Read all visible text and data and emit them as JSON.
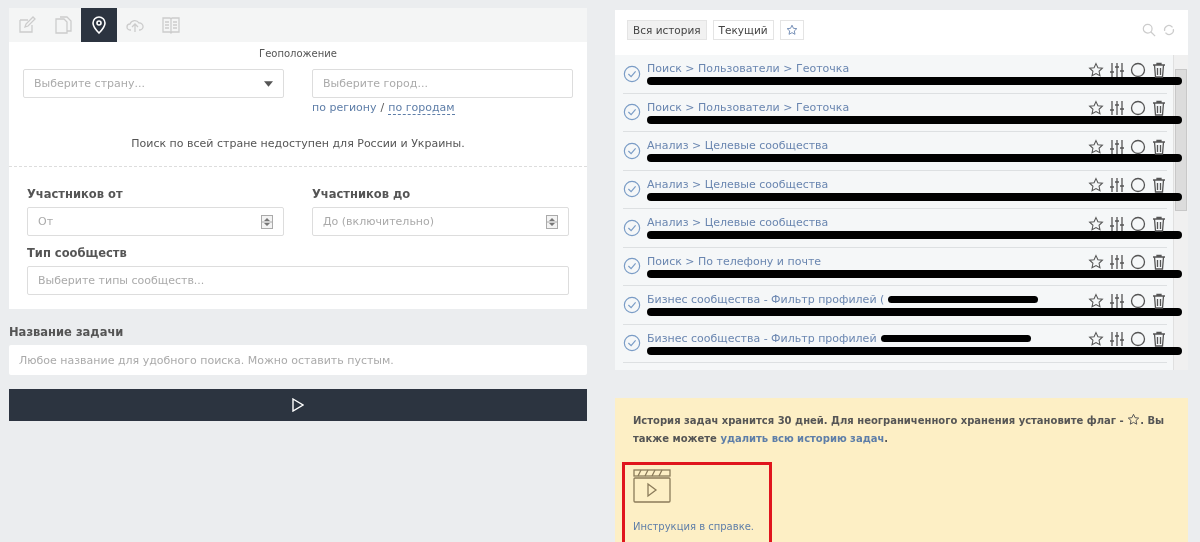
{
  "tabs": [
    {
      "kind": "edit",
      "selected": false
    },
    {
      "kind": "copy",
      "selected": false
    },
    {
      "kind": "pin",
      "selected": true
    },
    {
      "kind": "cloud",
      "selected": false
    },
    {
      "kind": "book",
      "selected": false
    }
  ],
  "geo": {
    "title": "Геоположение",
    "country": {
      "placeholder": "Выберите страну..."
    },
    "city": {
      "placeholder": "Выберите город..."
    },
    "links": [
      "по региону",
      "по городам"
    ],
    "separator": "/",
    "notice": "Поиск по всей стране недоступен для России и Украины."
  },
  "members": [
    {
      "label": "Участников от",
      "placeholder": "От"
    },
    {
      "label": "Участников до",
      "placeholder": "До (включительно)"
    }
  ],
  "community_type": {
    "label": "Тип сообществ",
    "placeholder": "Выберите типы сообществ..."
  },
  "task_name": {
    "label": "Название задачи",
    "placeholder": "Любое название для удобного поиска. Можно оставить пустым."
  },
  "history": {
    "filters": [
      {
        "kind": "text",
        "label": "Вся история",
        "selected": true
      },
      {
        "kind": "text",
        "label": "Текущий",
        "selected": false
      },
      {
        "kind": "star",
        "selected": false
      }
    ],
    "rows": [
      {
        "title": "Поиск > Пользователи > Геоточка",
        "title_redacted": false
      },
      {
        "title": "Поиск > Пользователи > Геоточка",
        "title_redacted": false
      },
      {
        "title": "Анализ > Целевые сообщества",
        "title_redacted": false
      },
      {
        "title": "Анализ > Целевые сообщества",
        "title_redacted": false
      },
      {
        "title": "Анализ > Целевые сообщества",
        "title_redacted": false
      },
      {
        "title": "Поиск > По телефону и почте",
        "title_redacted": false
      },
      {
        "title": "Бизнес сообщества - Фильтр профилей (",
        "title_redacted": true
      },
      {
        "title": "Бизнес сообщества - Фильтр профилей",
        "title_redacted": true
      }
    ]
  },
  "info": {
    "text_before": "История задач хранится 30 дней. Для неограниченного хранения установите флаг - ",
    "text_after": ". Вы также можете ",
    "link": "удалить всю историю задач",
    "text_end": "."
  },
  "help_link": "Инструкция в справке."
}
